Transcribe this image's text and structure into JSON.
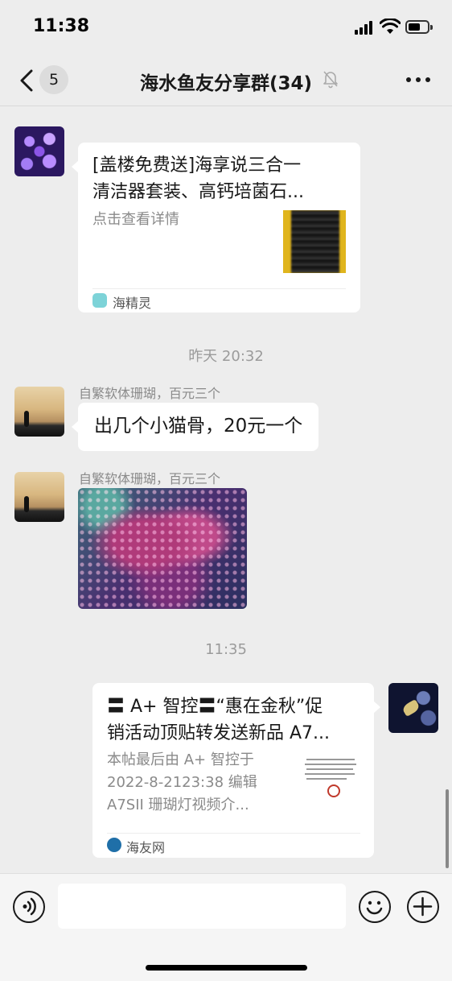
{
  "status_bar": {
    "time": "11:38"
  },
  "nav": {
    "unread_count": "5",
    "title": "海水鱼友分享群(34)"
  },
  "messages": {
    "card1": {
      "title": "[盖楼免费送]海享说三合一清洁器套装、高钙培菌石...",
      "title_line1": "[盖楼免费送]海享说三合一",
      "title_line2": "清洁器套装、高钙培菌石...",
      "desc": "点击查看详情",
      "source": "海精灵"
    },
    "time_1": "昨天 20:32",
    "text_msg": {
      "sender": "自繁软体珊瑚，百元三个",
      "text": "出几个小猫骨，20元一个"
    },
    "image_msg": {
      "sender": "自繁软体珊瑚，百元三个"
    },
    "time_2": "11:35",
    "card2": {
      "title_line1": "〓 A+ 智控〓“惠在金秋”促",
      "title_line2": "销活动顶贴转发送新品 A7...",
      "desc_line1": "本帖最后由 A+ 智控于",
      "desc_line2": "2022-8-2123:38 编辑",
      "desc_line3": "A7SII 珊瑚灯视频介...",
      "source": "海友网"
    }
  },
  "icons": {
    "back": "chevron-left-icon",
    "mute": "bell-off-icon",
    "more": "more-dots-icon",
    "voice": "voice-icon",
    "emoji": "emoji-icon",
    "add": "plus-icon"
  },
  "colors": {
    "background": "#ededed",
    "bubble": "#ffffff",
    "secondary_text": "#8a8a8a"
  }
}
